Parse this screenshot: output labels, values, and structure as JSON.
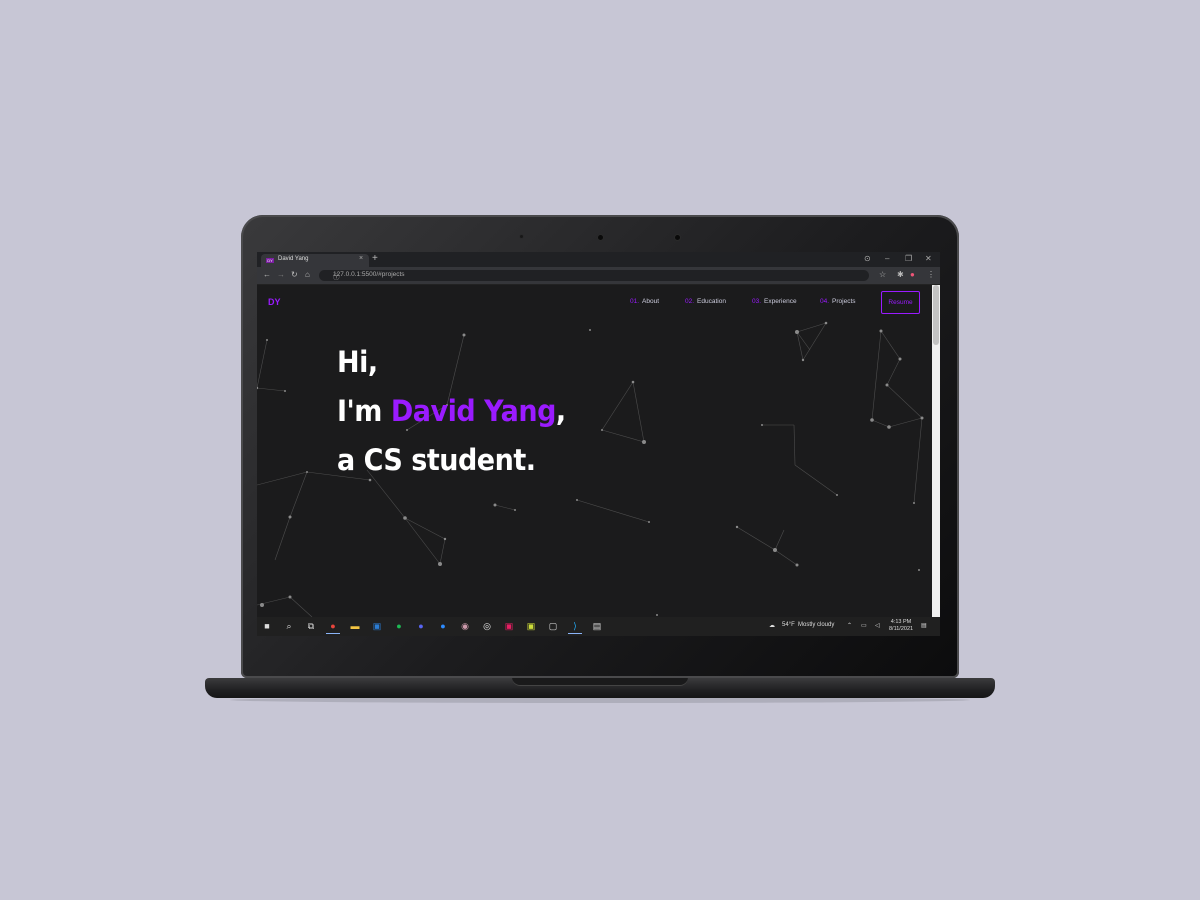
{
  "browser": {
    "tab_title": "David Yang",
    "favicon_text": "DY",
    "tab_close": "×",
    "new_tab": "+",
    "url": "127.0.0.1:5500/#projects",
    "controls": {
      "minimize": "–",
      "maximize": "❐",
      "close": "✕"
    }
  },
  "site": {
    "logo": "DY",
    "nav": [
      {
        "num": "01.",
        "label": "About"
      },
      {
        "num": "02.",
        "label": "Education"
      },
      {
        "num": "03.",
        "label": "Experience"
      },
      {
        "num": "04.",
        "label": "Projects"
      }
    ],
    "resume_label": "Resume",
    "hero": {
      "line1": "Hi,",
      "line2_prefix": "I'm ",
      "line2_name": "David Yang",
      "line2_suffix": ",",
      "line3": "a CS student."
    }
  },
  "taskbar": {
    "apps": [
      "start-icon",
      "search-icon",
      "task-view-icon",
      "chrome-icon",
      "file-explorer-icon",
      "word-icon",
      "spotify-icon",
      "discord-icon",
      "zoom-icon",
      "app-icon",
      "app-icon",
      "jetbrains-icon",
      "app-icon",
      "app-icon",
      "vscode-icon",
      "app-icon"
    ],
    "weather_temp": "54°F",
    "weather_text": "Mostly cloudy",
    "time": "4:13 PM",
    "date": "8/11/2021"
  },
  "colors": {
    "accent": "#9a1bff",
    "background": "#1b1b1c",
    "desk": "#c7c6d5"
  }
}
